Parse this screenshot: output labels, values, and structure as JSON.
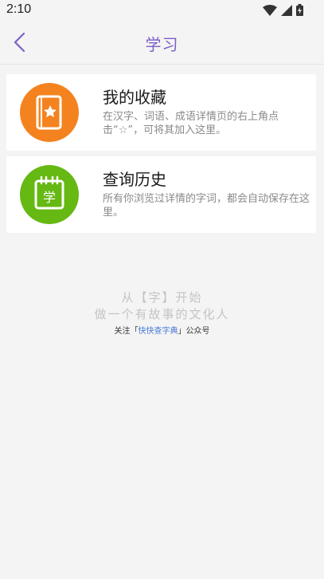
{
  "status_bar": {
    "time": "2:10"
  },
  "header": {
    "title": "学习"
  },
  "cards": [
    {
      "title": "我的收藏",
      "description": "在汉字、词语、成语详情页的右上角点击“☆”，可将其加入这里。",
      "icon": "bookmark-star-icon",
      "icon_color": "#f4831f"
    },
    {
      "title": "查询历史",
      "description": "所有你浏览过详情的字词，都会自动保存在这里。",
      "icon": "notebook-xue-icon",
      "icon_color": "#66b812",
      "icon_glyph": "学"
    }
  ],
  "footer": {
    "slogan_line1": "从【字】开始",
    "slogan_line2": "做一个有故事的文化人",
    "follow_prefix": "关注「",
    "follow_name": "快快查字典",
    "follow_suffix": "」公众号"
  },
  "colors": {
    "accent": "#7a5fc8",
    "orange": "#f4831f",
    "green": "#66b812"
  }
}
